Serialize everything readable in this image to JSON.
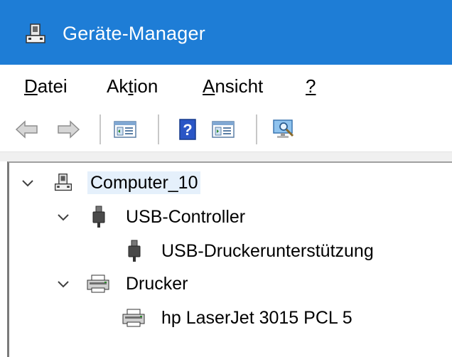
{
  "window": {
    "title": "Geräte-Manager",
    "accent_color": "#1e7dd6",
    "title_icon": "device-manager-icon"
  },
  "menu": {
    "items": [
      {
        "label_acc": "D",
        "label_rest": "atei"
      },
      {
        "label_pre": "Ak",
        "label_acc": "t",
        "label_rest": "ion"
      },
      {
        "label_acc": "A",
        "label_rest": "nsicht"
      },
      {
        "label_acc": "?",
        "label_rest": ""
      }
    ]
  },
  "toolbar": {
    "buttons": [
      "back-arrow-icon",
      "forward-arrow-icon",
      "show-hide-console-tree-icon",
      "help-icon",
      "properties-pane-icon",
      "scan-hardware-icon"
    ]
  },
  "tree": {
    "root": {
      "label": "Computer_10",
      "expanded": true,
      "icon": "computer-icon"
    },
    "children": [
      {
        "label": "USB-Controller",
        "expanded": true,
        "icon": "usb-plug-icon",
        "children": [
          {
            "label": "USB-Druckerunterstützung",
            "icon": "usb-plug-icon"
          }
        ]
      },
      {
        "label": "Drucker",
        "expanded": true,
        "icon": "printer-icon",
        "children": [
          {
            "label": "hp LaserJet 3015 PCL 5",
            "icon": "printer-icon"
          }
        ]
      }
    ]
  }
}
